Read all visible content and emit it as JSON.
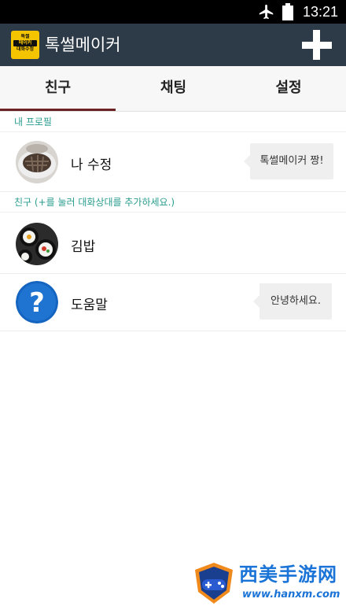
{
  "status_bar": {
    "time": "13:21",
    "icons": [
      "airplane-icon",
      "battery-icon"
    ]
  },
  "app_bar": {
    "logo_lines": [
      "톡썰",
      "메이커",
      "대화수정"
    ],
    "title": "톡썰메이커",
    "add_icon": "plus-icon"
  },
  "tabs": [
    {
      "label": "친구",
      "selected": true
    },
    {
      "label": "채팅",
      "selected": false
    },
    {
      "label": "설정",
      "selected": false
    }
  ],
  "my_profile": {
    "header": "내 프로필",
    "name": "나 수정",
    "status_message": "톡썰메이커 짱!"
  },
  "friends": {
    "header": "친구 (+를 눌러 대화상대를 추가하세요.)",
    "items": [
      {
        "name": "김밥",
        "status_message": ""
      },
      {
        "name": "도움말",
        "status_message": "안녕하세요."
      }
    ]
  },
  "watermark": {
    "text": "西美手游网",
    "url": "www.hanxm.com"
  },
  "colors": {
    "status_bar": "#000000",
    "app_bar": "#2d3a48",
    "logo": "#f5c400",
    "tab_indicator": "#6b2222",
    "section_header_text": "#2a9d8f",
    "bubble": "#efefef",
    "help_icon": "#1565c0"
  }
}
